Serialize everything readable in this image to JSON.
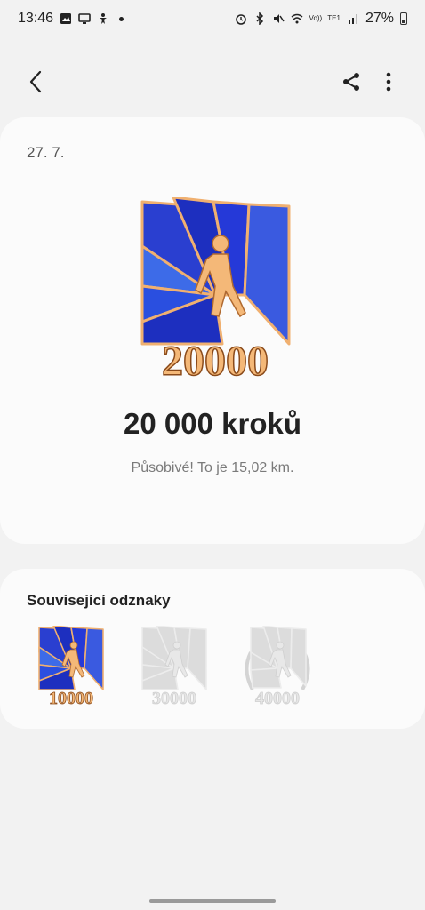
{
  "status_bar": {
    "time": "13:46",
    "battery": "27%",
    "network": "Vo)) LTE1"
  },
  "header": {
    "back_icon": "chevron-left-icon",
    "share_icon": "share-icon",
    "more_icon": "more-vertical-icon"
  },
  "achievement": {
    "date": "27. 7.",
    "badge_number": "20000",
    "title": "20 000 kroků",
    "subtitle": "Působivé! To je 15,02 km."
  },
  "related": {
    "title": "Související odznaky",
    "badges": [
      {
        "number": "10000",
        "state": "earned"
      },
      {
        "number": "30000",
        "state": "locked"
      },
      {
        "number": "40000",
        "state": "locked"
      }
    ]
  },
  "colors": {
    "badge_blue_dark": "#1d2fbf",
    "badge_blue_light": "#3a6be8",
    "badge_gold": "#f0b070",
    "locked_gray": "#d8d8d8"
  }
}
